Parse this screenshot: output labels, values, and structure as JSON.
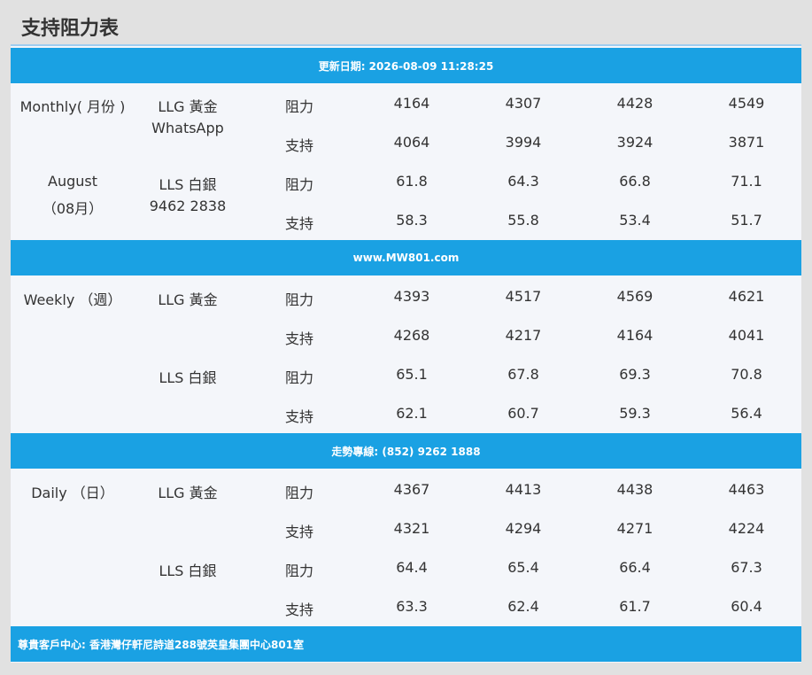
{
  "title": "支持阻力表",
  "bars": {
    "updated": "更新日期: 2026-08-09 11:28:25",
    "website": "www.MW801.com",
    "hotline": "走勢專線: (852) 9262 1888",
    "address": "尊貴客戶中心: 香港灣仔軒尼詩道288號英皇集團中心801室"
  },
  "labels": {
    "resistance": "阻力",
    "support": "支持"
  },
  "monthly": {
    "period": "Monthly( 月份 )",
    "month": "August",
    "month_cn": "（08月）",
    "llg": "LLG 黃金",
    "whatsapp": "WhatsApp",
    "lls": "LLS 白銀",
    "phone": "9462 2838",
    "llg_resistance": [
      "4164",
      "4307",
      "4428",
      "4549"
    ],
    "llg_support": [
      "4064",
      "3994",
      "3924",
      "3871"
    ],
    "lls_resistance": [
      "61.8",
      "64.3",
      "66.8",
      "71.1"
    ],
    "lls_support": [
      "58.3",
      "55.8",
      "53.4",
      "51.7"
    ]
  },
  "weekly": {
    "period": "Weekly （週）",
    "llg": "LLG 黃金",
    "lls": "LLS 白銀",
    "llg_resistance": [
      "4393",
      "4517",
      "4569",
      "4621"
    ],
    "llg_support": [
      "4268",
      "4217",
      "4164",
      "4041"
    ],
    "lls_resistance": [
      "65.1",
      "67.8",
      "69.3",
      "70.8"
    ],
    "lls_support": [
      "62.1",
      "60.7",
      "59.3",
      "56.4"
    ]
  },
  "daily": {
    "period": "Daily （日）",
    "llg": "LLG 黃金",
    "lls": "LLS 白銀",
    "llg_resistance": [
      "4367",
      "4413",
      "4438",
      "4463"
    ],
    "llg_support": [
      "4321",
      "4294",
      "4271",
      "4224"
    ],
    "lls_resistance": [
      "64.4",
      "65.4",
      "66.4",
      "67.3"
    ],
    "lls_support": [
      "63.3",
      "62.4",
      "61.7",
      "60.4"
    ]
  },
  "colors": {
    "bar": "#1aa1e3",
    "panel": "#f4f6fa",
    "page": "#e1e1e1"
  }
}
